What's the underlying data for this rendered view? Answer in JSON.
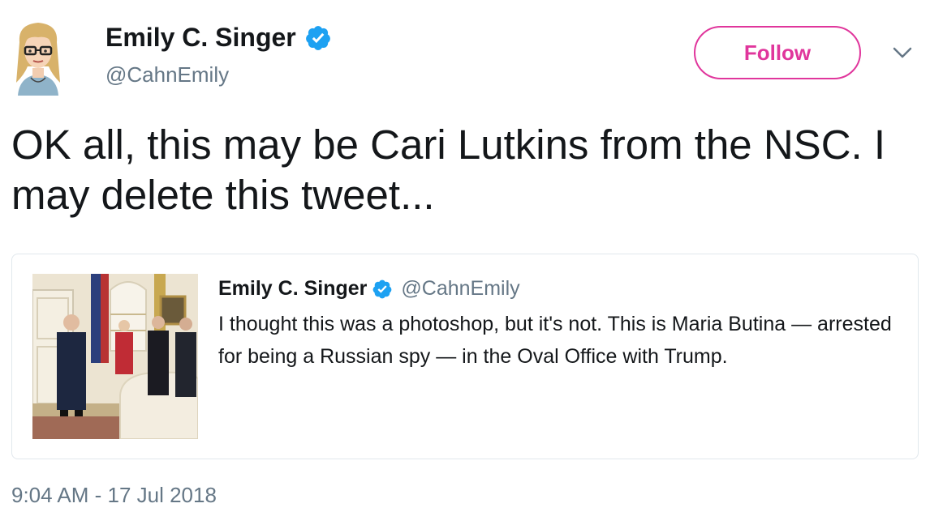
{
  "author": {
    "name": "Emily C. Singer",
    "handle": "@CahnEmily",
    "verified_icon": "verified-badge-icon",
    "avatar_icon": "bitmoji-avatar"
  },
  "actions": {
    "follow_label": "Follow",
    "more_icon": "chevron-down-icon"
  },
  "tweet": {
    "text": "OK all, this may be Cari Lutkins from the NSC. I may delete this tweet...",
    "timestamp": "9:04 AM - 17 Jul 2018"
  },
  "quoted_tweet": {
    "name": "Emily C. Singer",
    "handle": "@CahnEmily",
    "text": "I thought this was a photoshop, but it's not. This is Maria Butina — arrested for being a Russian spy — in the Oval Office with Trump.",
    "media_icon": "oval-office-photo"
  },
  "colors": {
    "accent": "#e0369c",
    "verified": "#1da1f2",
    "muted": "#657786",
    "text": "#14171a",
    "border": "#e1e8ed"
  }
}
